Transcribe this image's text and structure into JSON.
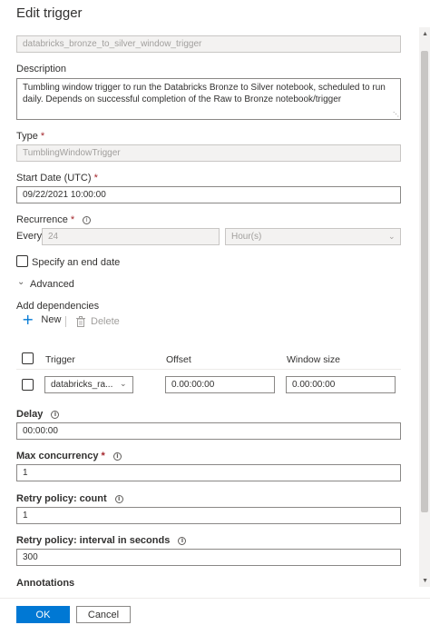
{
  "panel": {
    "title": "Edit trigger"
  },
  "name_field": {
    "value": "databricks_bronze_to_silver_window_trigger"
  },
  "description": {
    "label": "Description",
    "value": "Tumbling window trigger to run the Databricks Bronze to Silver notebook, scheduled to run daily. Depends on successful completion of the Raw to Bronze notebook/trigger"
  },
  "type": {
    "label": "Type",
    "required_mark": "*",
    "value": "TumblingWindowTrigger"
  },
  "start_date": {
    "label": "Start Date (UTC)",
    "required_mark": "*",
    "value": "09/22/2021 10:00:00"
  },
  "recurrence": {
    "label": "Recurrence",
    "required_mark": "*",
    "every_label": "Every",
    "interval": "24",
    "unit": "Hour(s)"
  },
  "end_date": {
    "label": "Specify an end date",
    "checked": false
  },
  "advanced": {
    "label": "Advanced",
    "expanded": true
  },
  "dependencies": {
    "label": "Add dependencies",
    "new_label": "New",
    "delete_label": "Delete",
    "columns": [
      "Trigger",
      "Offset",
      "Window size"
    ],
    "rows": [
      {
        "trigger": "databricks_ra...",
        "offset": "0.00:00:00",
        "window_size": "0.00:00:00"
      }
    ]
  },
  "delay": {
    "label": "Delay",
    "value": "00:00:00"
  },
  "max_concurrency": {
    "label": "Max concurrency",
    "required_mark": "*",
    "value": "1"
  },
  "retry_count": {
    "label": "Retry policy: count",
    "value": "1"
  },
  "retry_interval": {
    "label": "Retry policy: interval in seconds",
    "value": "300"
  },
  "annotations": {
    "label": "Annotations"
  },
  "footer": {
    "ok_label": "OK",
    "cancel_label": "Cancel"
  },
  "colors": {
    "accent": "#0078d4",
    "required": "#a4262c",
    "disabled_bg": "#f3f2f1"
  },
  "icons": [
    "info-icon",
    "plus-icon",
    "trash-icon",
    "chevron-down-icon",
    "scroll-up-icon",
    "scroll-down-icon"
  ]
}
